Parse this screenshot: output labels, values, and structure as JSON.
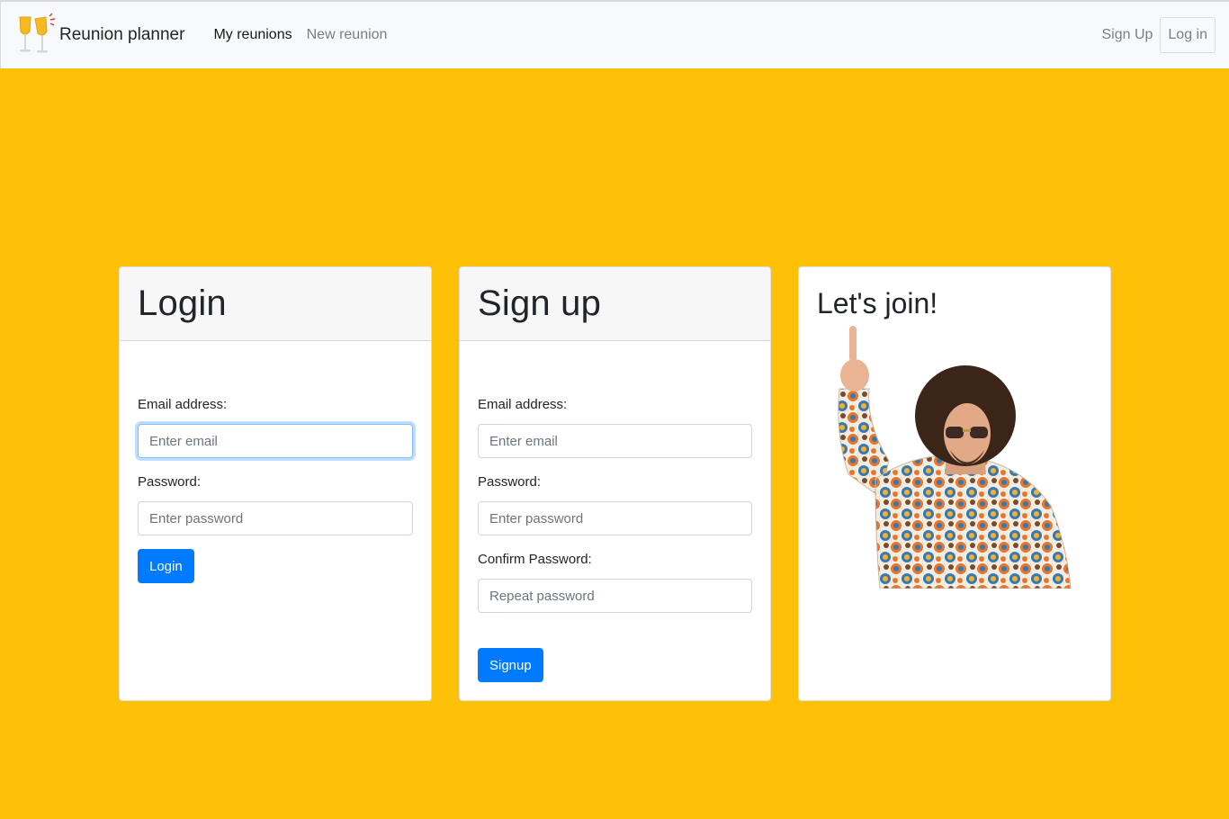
{
  "navbar": {
    "brand": "Reunion planner",
    "logo_icon": "champagne-glasses-icon",
    "links": [
      "My reunions",
      "New reunion"
    ],
    "signup_label": "Sign Up",
    "login_label": "Log in"
  },
  "login_card": {
    "title": "Login",
    "email_label": "Email address:",
    "email_placeholder": "Enter email",
    "password_label": "Password:",
    "password_placeholder": "Enter password",
    "button_label": "Login"
  },
  "signup_card": {
    "title": "Sign up",
    "email_label": "Email address:",
    "email_placeholder": "Enter email",
    "password_label": "Password:",
    "password_placeholder": "Enter password",
    "confirm_label": "Confirm Password:",
    "confirm_placeholder": "Repeat password",
    "button_label": "Signup"
  },
  "join_card": {
    "title": "Let's join!",
    "image": "person-in-retro-shirt-pointing-up"
  },
  "colors": {
    "background": "#ffc107",
    "primary": "#007bff",
    "navbar": "#f8f9fa"
  }
}
